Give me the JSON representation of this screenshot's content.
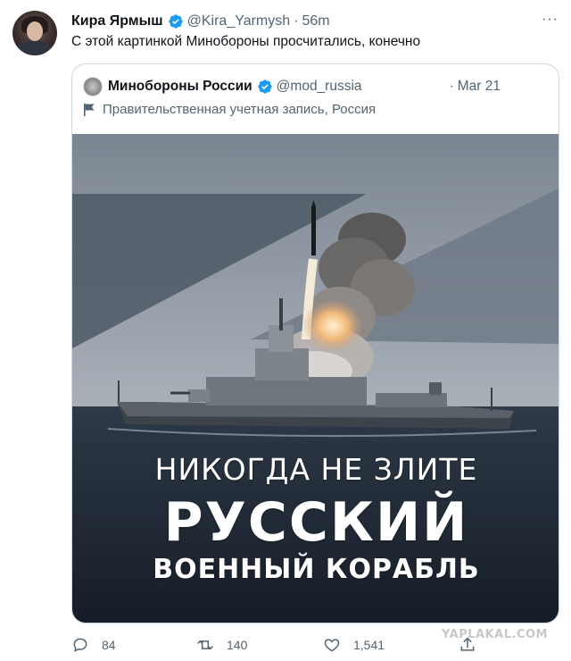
{
  "tweet": {
    "author_name": "Кира Ярмыш",
    "handle": "@Kira_Yarmysh",
    "separator": "·",
    "time": "56m",
    "more": "···",
    "text": "С этой картинкой Минобороны просчитались, конечно"
  },
  "quoted": {
    "author_name": "Минобороны России",
    "handle": "@mod_russia",
    "separator": "·",
    "date": "Mar 21",
    "gov_label": "Правительственная учетная запись, Россия",
    "poster": {
      "line1": "НИКОГДА НЕ ЗЛИТЕ",
      "line2": "РУССКИЙ",
      "line3": "ВОЕННЫЙ КОРАБЛЬ"
    }
  },
  "actions": {
    "replies": "84",
    "retweets": "140",
    "likes": "1,541"
  },
  "watermark": "YAPLAKAL.COM",
  "colors": {
    "verified": "#1d9bf0",
    "muted": "#536471",
    "border": "#cfd9de"
  },
  "icons": [
    "verified-badge-icon",
    "flag-icon",
    "reply-icon",
    "retweet-icon",
    "like-icon",
    "share-icon",
    "more-icon"
  ]
}
